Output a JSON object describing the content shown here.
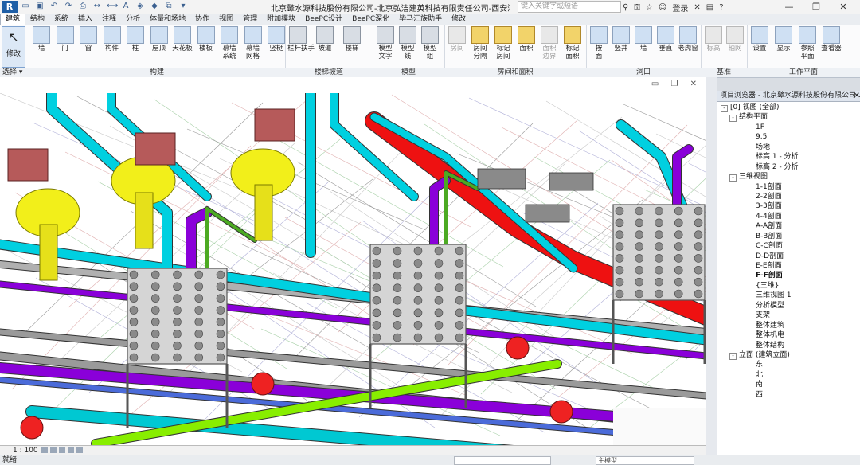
{
  "app": {
    "logo_letter": "R",
    "doc_title": "北京鼙水源科技股份有限公司-北京弘洁建英科技有限责任公司-西安湾子水厂...",
    "search_placeholder": "键入关键字或短语",
    "login_label": "登录",
    "help_label": "?"
  },
  "tabs": [
    "建筑",
    "结构",
    "系统",
    "插入",
    "注释",
    "分析",
    "体量和场地",
    "协作",
    "视图",
    "管理",
    "附加模块",
    "BeePC设计",
    "BeePC深化",
    "毕马汇族助手",
    "修改"
  ],
  "ribbon": {
    "modify_label": "修改",
    "select_label": "选择",
    "groups": [
      {
        "label": "构建",
        "tools": [
          "墙",
          "门",
          "窗",
          "构件",
          "柱",
          "屋顶",
          "天花板",
          "楼板",
          "幕墙\n系统",
          "幕墙\n网格",
          "竖梃"
        ]
      },
      {
        "label": "楼梯坡道",
        "tools": [
          "栏杆扶手",
          "坡道",
          "楼梯"
        ]
      },
      {
        "label": "模型",
        "tools": [
          "模型\n文字",
          "模型\n线",
          "模型\n组"
        ]
      },
      {
        "label": "房间和面积",
        "tools": [
          "房间",
          "房间\n分隔",
          "标记\n房间",
          "面积",
          "面积\n边界",
          "标记\n面积"
        ]
      },
      {
        "label": "洞口",
        "tools": [
          "按\n面",
          "竖井",
          "墙",
          "垂直",
          "老虎窗"
        ]
      },
      {
        "label": "基准",
        "tools": [
          "标高",
          "轴网"
        ]
      },
      {
        "label": "工作平面",
        "tools": [
          "设置",
          "显示",
          "参照\n平面",
          "查看器"
        ]
      }
    ]
  },
  "viewport": {
    "scale": "1 : 100"
  },
  "status": {
    "ready": "就绪",
    "model_box": "主模型"
  },
  "browser": {
    "title": "项目浏览器 - 北京鼙水源科技股份有限公司-...",
    "tree": [
      {
        "label": "[0] 视图 (全部)",
        "level": 0,
        "toggle": "-"
      },
      {
        "label": "结构平面",
        "level": 1,
        "toggle": "-"
      },
      {
        "label": "1F",
        "level": 2
      },
      {
        "label": "9.5",
        "level": 2
      },
      {
        "label": "场地",
        "level": 2
      },
      {
        "label": "标高 1 - 分析",
        "level": 2
      },
      {
        "label": "标高 2 - 分析",
        "level": 2
      },
      {
        "label": "三维视图",
        "level": 1,
        "toggle": "-"
      },
      {
        "label": "1-1剖面",
        "level": 2
      },
      {
        "label": "2-2剖面",
        "level": 2
      },
      {
        "label": "3-3剖面",
        "level": 2
      },
      {
        "label": "4-4剖面",
        "level": 2
      },
      {
        "label": "A-A剖面",
        "level": 2
      },
      {
        "label": "B-B剖面",
        "level": 2
      },
      {
        "label": "C-C剖面",
        "level": 2
      },
      {
        "label": "D-D剖面",
        "level": 2
      },
      {
        "label": "E-E剖面",
        "level": 2
      },
      {
        "label": "F-F剖面",
        "level": 2,
        "bold": true
      },
      {
        "label": "{三维}",
        "level": 2
      },
      {
        "label": "三维视图 1",
        "level": 2
      },
      {
        "label": "分析模型",
        "level": 2
      },
      {
        "label": "支架",
        "level": 2
      },
      {
        "label": "整体建筑",
        "level": 2
      },
      {
        "label": "整体机电",
        "level": 2
      },
      {
        "label": "整体结构",
        "level": 2
      },
      {
        "label": "立面 (建筑立面)",
        "level": 1,
        "toggle": "-"
      },
      {
        "label": "东",
        "level": 2
      },
      {
        "label": "北",
        "level": 2
      },
      {
        "label": "南",
        "level": 2
      },
      {
        "label": "西",
        "level": 2
      }
    ]
  }
}
